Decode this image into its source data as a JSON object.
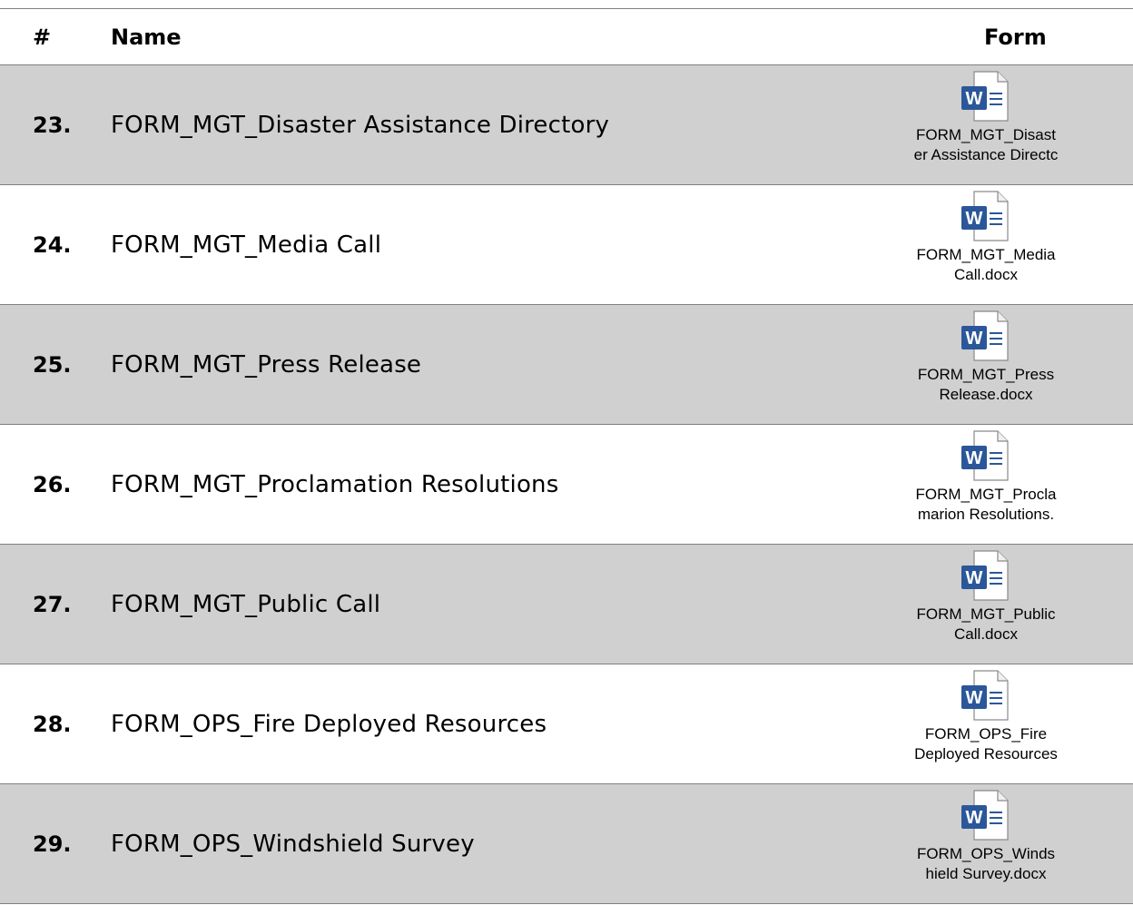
{
  "header": {
    "num": "#",
    "name": "Name",
    "form": "Form"
  },
  "rows": [
    {
      "num": "23.",
      "name": "FORM_MGT_Disaster Assistance Directory",
      "file_line1": "FORM_MGT_Disast",
      "file_line2": "er Assistance Directc",
      "icon": "word-document-icon",
      "shaded": true
    },
    {
      "num": "24.",
      "name": "FORM_MGT_Media Call",
      "file_line1": "FORM_MGT_Media",
      "file_line2": "Call.docx",
      "icon": "word-document-icon",
      "shaded": false
    },
    {
      "num": "25.",
      "name": "FORM_MGT_Press Release",
      "file_line1": "FORM_MGT_Press",
      "file_line2": "Release.docx",
      "icon": "word-document-icon",
      "shaded": true
    },
    {
      "num": "26.",
      "name": "FORM_MGT_Proclamation Resolutions",
      "file_line1": "FORM_MGT_Procla",
      "file_line2": "marion Resolutions.",
      "icon": "word-document-icon",
      "shaded": false
    },
    {
      "num": "27.",
      "name": "FORM_MGT_Public Call",
      "file_line1": "FORM_MGT_Public",
      "file_line2": "Call.docx",
      "icon": "word-document-icon",
      "shaded": true
    },
    {
      "num": "28.",
      "name": "FORM_OPS_Fire Deployed Resources",
      "file_line1": "FORM_OPS_Fire",
      "file_line2": "Deployed Resources",
      "icon": "word-document-icon",
      "shaded": false
    },
    {
      "num": "29.",
      "name": "FORM_OPS_Windshield Survey",
      "file_line1": "FORM_OPS_Winds",
      "file_line2": "hield Survey.docx",
      "icon": "word-document-icon",
      "shaded": true
    }
  ],
  "colors": {
    "shaded_row": "#d0d0d0",
    "plain_row": "#ffffff",
    "word_blue": "#2b579a",
    "rule": "#7f7f7f"
  }
}
